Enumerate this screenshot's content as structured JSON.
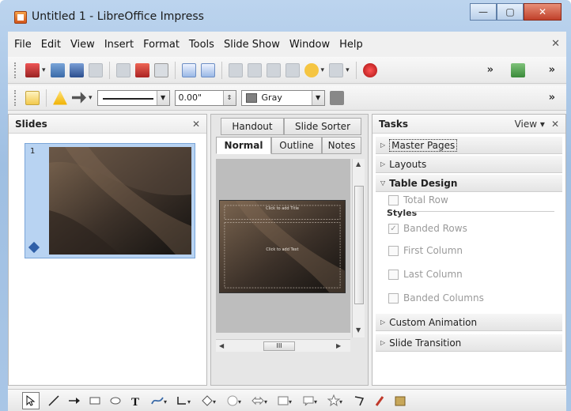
{
  "window": {
    "title": "Untitled 1 - LibreOffice Impress",
    "buttons": {
      "minimize": "—",
      "maximize": "▢",
      "close": "✕"
    }
  },
  "menu": [
    "File",
    "Edit",
    "View",
    "Insert",
    "Format",
    "Tools",
    "Slide Show",
    "Window",
    "Help"
  ],
  "menu_close": "✕",
  "line_toolbar": {
    "line_width": "0.00\"",
    "line_color": "Gray",
    "line_color_hex": "#808080"
  },
  "toolbar_overflow": "»",
  "slides_panel": {
    "title": "Slides",
    "close": "✕",
    "slides": [
      {
        "number": "1"
      }
    ]
  },
  "view_tabs": {
    "row1": [
      "Handout",
      "Slide Sorter"
    ],
    "row2": [
      "Normal",
      "Outline",
      "Notes"
    ],
    "active": "Normal"
  },
  "slide": {
    "title_placeholder": "Click to add Title",
    "text_placeholder": "Click to add Text"
  },
  "scroll": {
    "hthumb": "III"
  },
  "tasks_panel": {
    "title": "Tasks",
    "view_label": "View",
    "close": "✕",
    "sections": [
      {
        "label": "Master Pages",
        "expanded": false
      },
      {
        "label": "Layouts",
        "expanded": false
      },
      {
        "label": "Table Design",
        "expanded": true
      },
      {
        "label": "Custom Animation",
        "expanded": false
      },
      {
        "label": "Slide Transition",
        "expanded": false
      }
    ],
    "table_design": {
      "overlap_text": "Total Row",
      "styles_label": "Styles",
      "options": [
        {
          "label": "Banded Rows",
          "checked": true
        },
        {
          "label": "First Column",
          "checked": false
        },
        {
          "label": "Last Column",
          "checked": false
        },
        {
          "label": "Banded Columns",
          "checked": false
        }
      ]
    }
  },
  "colors": {
    "slide_bg_dark": "#1e1b18",
    "slide_bg_brown": "#6a5340",
    "slide_sel": "#b8d3f2"
  }
}
